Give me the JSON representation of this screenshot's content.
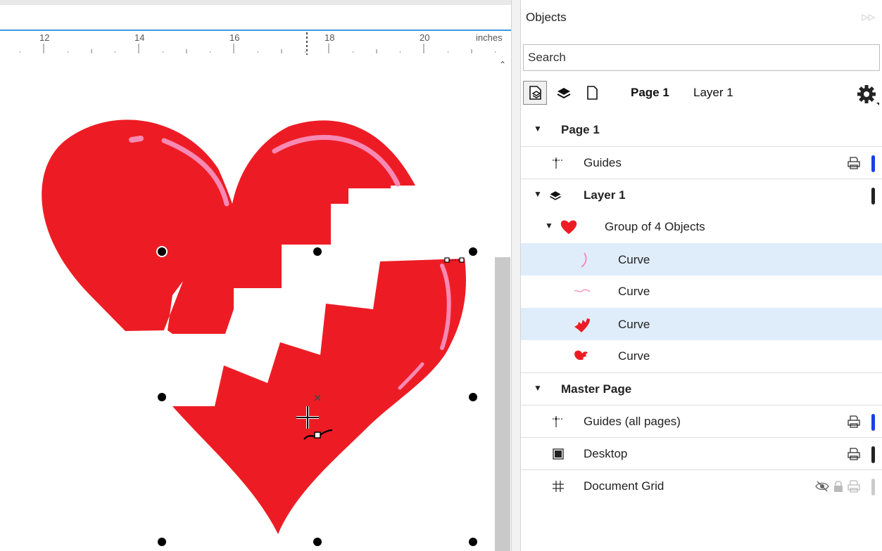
{
  "ruler": {
    "unit": "inches",
    "labels": [
      "12",
      "14",
      "16",
      "18",
      "20"
    ]
  },
  "panel": {
    "title": "Objects",
    "search": {
      "placeholder": "Search",
      "value": ""
    },
    "toolbar": {
      "page_name": "Page 1",
      "layer_name": "Layer 1"
    },
    "tree": [
      {
        "label": "Page 1",
        "bold": true,
        "toggle": "▼",
        "icon": "none",
        "selected": false
      },
      {
        "label": "Guides",
        "bold": false,
        "toggle": "",
        "icon": "guides-icon",
        "selected": false,
        "printer": true,
        "color": "#1a3fe6"
      },
      {
        "label": "Layer 1",
        "bold": true,
        "toggle": "▼",
        "icon": "layers-icon",
        "selected": false,
        "color": "#222222"
      },
      {
        "label": "Group of 4 Objects",
        "bold": false,
        "toggle": "▼",
        "icon": "heart-thumb-icon",
        "selected": false
      },
      {
        "label": "Curve",
        "bold": false,
        "toggle": "",
        "icon": "pink-highlight-thumb-icon",
        "selected": true
      },
      {
        "label": "Curve",
        "bold": false,
        "toggle": "",
        "icon": "pink-squiggle-thumb-icon",
        "selected": false
      },
      {
        "label": "Curve",
        "bold": false,
        "toggle": "",
        "icon": "heart-piece-thumb-icon",
        "selected": true
      },
      {
        "label": "Curve",
        "bold": false,
        "toggle": "",
        "icon": "heart-half-thumb-icon",
        "selected": false
      },
      {
        "label": "Master Page",
        "bold": true,
        "toggle": "▼",
        "icon": "none",
        "selected": false
      },
      {
        "label": "Guides (all pages)",
        "bold": false,
        "toggle": "",
        "icon": "guides-icon",
        "selected": false,
        "printer": true,
        "color": "#1a3fe6"
      },
      {
        "label": "Desktop",
        "bold": false,
        "toggle": "",
        "icon": "desktop-icon",
        "selected": false,
        "printer": true,
        "color": "#222222"
      },
      {
        "label": "Document Grid",
        "bold": false,
        "toggle": "",
        "icon": "grid-icon",
        "selected": false,
        "printer": true,
        "hidden_locked": true,
        "color": "#cccccc"
      }
    ]
  },
  "colors": {
    "heart_red": "#ed1c24",
    "highlight_pink": "#f68ab4",
    "selection_blue": "#dfedfb"
  }
}
